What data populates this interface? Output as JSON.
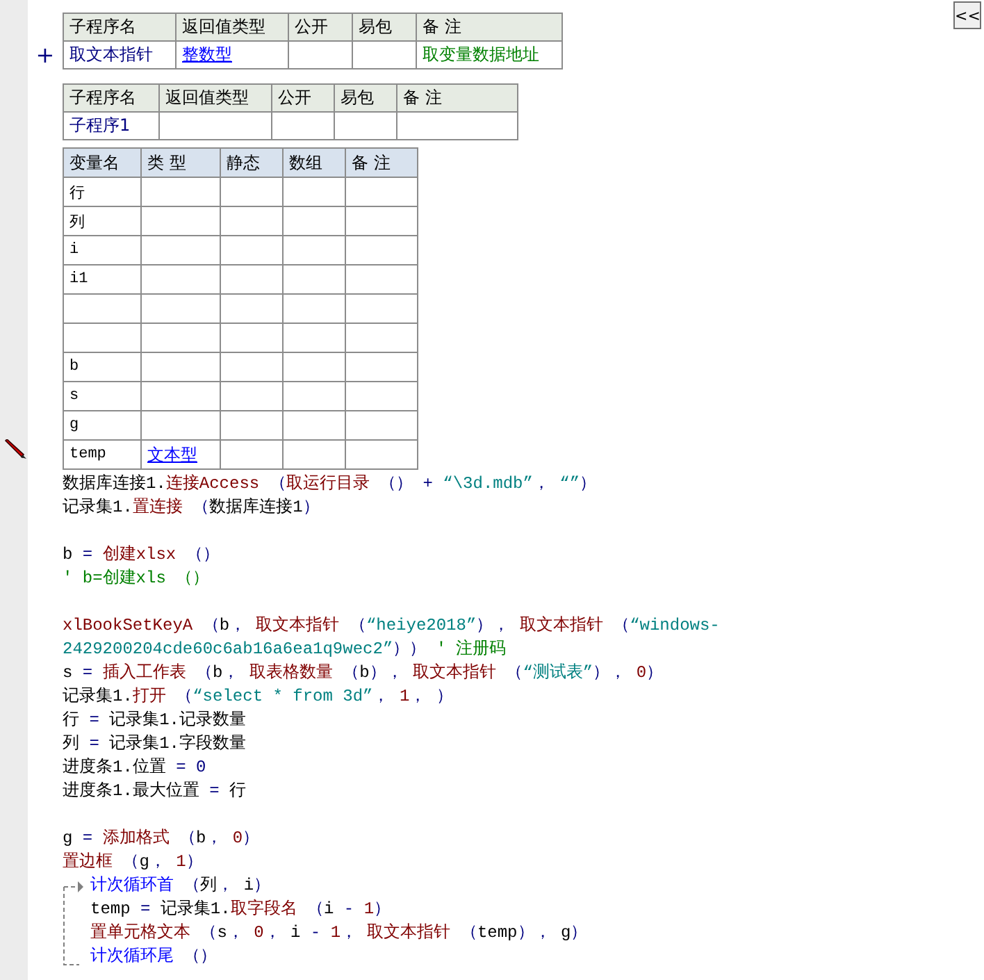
{
  "collapse_button": {
    "label": "<<"
  },
  "subroutine_tables": [
    {
      "marker": "+",
      "columns": [
        "子程序名",
        "返回值类型",
        "公开",
        "易包",
        "备 注"
      ],
      "rows": [
        {
          "name": "取文本指针",
          "return_type": "整数型",
          "remark": "取变量数据地址"
        }
      ]
    },
    {
      "columns": [
        "子程序名",
        "返回值类型",
        "公开",
        "易包",
        "备 注"
      ],
      "rows": [
        {
          "name": "子程序1"
        }
      ]
    }
  ],
  "variable_table": {
    "columns": [
      "变量名",
      "类 型",
      "静态",
      "数组",
      "备 注"
    ],
    "rows": [
      {
        "name": "行"
      },
      {
        "name": "列"
      },
      {
        "name": "i"
      },
      {
        "name": "i1"
      },
      {},
      {},
      {
        "name": "b"
      },
      {
        "name": "s"
      },
      {
        "name": "g"
      },
      {
        "name": "temp",
        "type": "文本型"
      }
    ]
  },
  "code": [
    {
      "kind": "code",
      "segments": [
        {
          "text": "数据库连接1.",
          "kind": "plain"
        },
        {
          "text": "连接Access",
          "kind": "call"
        },
        {
          "text": " （",
          "kind": "punct"
        },
        {
          "text": "取运行目录",
          "kind": "call"
        },
        {
          "text": " （） + ",
          "kind": "punct"
        },
        {
          "text": "“\\3d.mdb”",
          "kind": "string"
        },
        {
          "text": "， ",
          "kind": "punct"
        },
        {
          "text": "“”",
          "kind": "string"
        },
        {
          "text": "）",
          "kind": "punct"
        }
      ]
    },
    {
      "kind": "code",
      "segments": [
        {
          "text": "记录集1.",
          "kind": "plain"
        },
        {
          "text": "置连接",
          "kind": "call"
        },
        {
          "text": " （",
          "kind": "punct"
        },
        {
          "text": "数据库连接1",
          "kind": "plain"
        },
        {
          "text": "）",
          "kind": "punct"
        }
      ]
    },
    {
      "kind": "blank"
    },
    {
      "kind": "code",
      "segments": [
        {
          "text": "b",
          "kind": "plain"
        },
        {
          "text": " = ",
          "kind": "punct"
        },
        {
          "text": "创建xlsx",
          "kind": "call"
        },
        {
          "text": " （）",
          "kind": "punct"
        }
      ]
    },
    {
      "kind": "code",
      "segments": [
        {
          "text": "' b=创建xls （）",
          "kind": "comment"
        }
      ]
    },
    {
      "kind": "blank"
    },
    {
      "kind": "code",
      "segments": [
        {
          "text": "xlBookSetKeyA",
          "kind": "call"
        },
        {
          "text": " （",
          "kind": "punct"
        },
        {
          "text": "b",
          "kind": "plain"
        },
        {
          "text": "， ",
          "kind": "punct"
        },
        {
          "text": "取文本指针",
          "kind": "call"
        },
        {
          "text": " （",
          "kind": "punct"
        },
        {
          "text": "“heiye2018”",
          "kind": "string"
        },
        {
          "text": "）， ",
          "kind": "punct"
        },
        {
          "text": "取文本指针",
          "kind": "call"
        },
        {
          "text": " （",
          "kind": "punct"
        },
        {
          "text": "“windows-2429200204cde60c6ab16a6ea1q9wec2”",
          "kind": "string"
        },
        {
          "text": "）） ",
          "kind": "punct"
        },
        {
          "text": "' 注册码",
          "kind": "comment"
        }
      ]
    },
    {
      "kind": "code",
      "segments": [
        {
          "text": "s",
          "kind": "plain"
        },
        {
          "text": " = ",
          "kind": "punct"
        },
        {
          "text": "插入工作表",
          "kind": "call"
        },
        {
          "text": " （",
          "kind": "punct"
        },
        {
          "text": "b",
          "kind": "plain"
        },
        {
          "text": "， ",
          "kind": "punct"
        },
        {
          "text": "取表格数量",
          "kind": "call"
        },
        {
          "text": " （",
          "kind": "punct"
        },
        {
          "text": "b",
          "kind": "plain"
        },
        {
          "text": "）， ",
          "kind": "punct"
        },
        {
          "text": "取文本指针",
          "kind": "call"
        },
        {
          "text": " （",
          "kind": "punct"
        },
        {
          "text": "“测试表”",
          "kind": "string"
        },
        {
          "text": "）， ",
          "kind": "punct"
        },
        {
          "text": "0",
          "kind": "number"
        },
        {
          "text": "）",
          "kind": "punct"
        }
      ]
    },
    {
      "kind": "code",
      "segments": [
        {
          "text": "记录集1.",
          "kind": "plain"
        },
        {
          "text": "打开",
          "kind": "call"
        },
        {
          "text": " （",
          "kind": "punct"
        },
        {
          "text": "“select * from 3d”",
          "kind": "string"
        },
        {
          "text": "， ",
          "kind": "punct"
        },
        {
          "text": "1",
          "kind": "number"
        },
        {
          "text": "， ）",
          "kind": "punct"
        }
      ]
    },
    {
      "kind": "code",
      "segments": [
        {
          "text": "行",
          "kind": "plain"
        },
        {
          "text": " = ",
          "kind": "punct"
        },
        {
          "text": "记录集1.记录数量",
          "kind": "plain"
        }
      ]
    },
    {
      "kind": "code",
      "segments": [
        {
          "text": "列",
          "kind": "plain"
        },
        {
          "text": " = ",
          "kind": "punct"
        },
        {
          "text": "记录集1.字段数量",
          "kind": "plain"
        }
      ]
    },
    {
      "kind": "code",
      "segments": [
        {
          "text": "进度条1.位置",
          "kind": "plain"
        },
        {
          "text": " = 0",
          "kind": "punct"
        }
      ]
    },
    {
      "kind": "code",
      "segments": [
        {
          "text": "进度条1.最大位置",
          "kind": "plain"
        },
        {
          "text": " = ",
          "kind": "punct"
        },
        {
          "text": "行",
          "kind": "plain"
        }
      ]
    },
    {
      "kind": "blank"
    },
    {
      "kind": "code",
      "segments": [
        {
          "text": "g",
          "kind": "plain"
        },
        {
          "text": " = ",
          "kind": "punct"
        },
        {
          "text": "添加格式",
          "kind": "call"
        },
        {
          "text": " （",
          "kind": "punct"
        },
        {
          "text": "b",
          "kind": "plain"
        },
        {
          "text": "， ",
          "kind": "punct"
        },
        {
          "text": "0",
          "kind": "number"
        },
        {
          "text": "）",
          "kind": "punct"
        }
      ]
    },
    {
      "kind": "code",
      "segments": [
        {
          "text": "置边框",
          "kind": "call"
        },
        {
          "text": " （",
          "kind": "punct"
        },
        {
          "text": "g",
          "kind": "plain"
        },
        {
          "text": "， ",
          "kind": "punct"
        },
        {
          "text": "1",
          "kind": "number"
        },
        {
          "text": "）",
          "kind": "punct"
        }
      ]
    },
    {
      "kind": "loop",
      "head": [
        {
          "text": "计次循环首",
          "kind": "flow"
        },
        {
          "text": " （",
          "kind": "punct"
        },
        {
          "text": "列",
          "kind": "plain"
        },
        {
          "text": "， ",
          "kind": "punct"
        },
        {
          "text": "i",
          "kind": "plain"
        },
        {
          "text": "）",
          "kind": "punct"
        }
      ],
      "body": [
        {
          "kind": "code",
          "segments": [
            {
              "text": "temp",
              "kind": "plain"
            },
            {
              "text": " = ",
              "kind": "punct"
            },
            {
              "text": "记录集1.",
              "kind": "plain"
            },
            {
              "text": "取字段名",
              "kind": "call"
            },
            {
              "text": " （",
              "kind": "punct"
            },
            {
              "text": "i",
              "kind": "plain"
            },
            {
              "text": " - ",
              "kind": "punct"
            },
            {
              "text": "1",
              "kind": "number"
            },
            {
              "text": "）",
              "kind": "punct"
            }
          ]
        },
        {
          "kind": "code",
          "segments": [
            {
              "text": "置单元格文本",
              "kind": "call"
            },
            {
              "text": " （",
              "kind": "punct"
            },
            {
              "text": "s",
              "kind": "plain"
            },
            {
              "text": "， ",
              "kind": "punct"
            },
            {
              "text": "0",
              "kind": "number"
            },
            {
              "text": "， ",
              "kind": "punct"
            },
            {
              "text": "i",
              "kind": "plain"
            },
            {
              "text": " - ",
              "kind": "punct"
            },
            {
              "text": "1",
              "kind": "number"
            },
            {
              "text": "， ",
              "kind": "punct"
            },
            {
              "text": "取文本指针",
              "kind": "call"
            },
            {
              "text": " （",
              "kind": "punct"
            },
            {
              "text": "temp",
              "kind": "plain"
            },
            {
              "text": "）， ",
              "kind": "punct"
            },
            {
              "text": "g",
              "kind": "plain"
            },
            {
              "text": "）",
              "kind": "punct"
            }
          ]
        }
      ],
      "tail": [
        {
          "text": "计次循环尾",
          "kind": "flow"
        },
        {
          "text": " （）",
          "kind": "punct"
        }
      ]
    }
  ]
}
